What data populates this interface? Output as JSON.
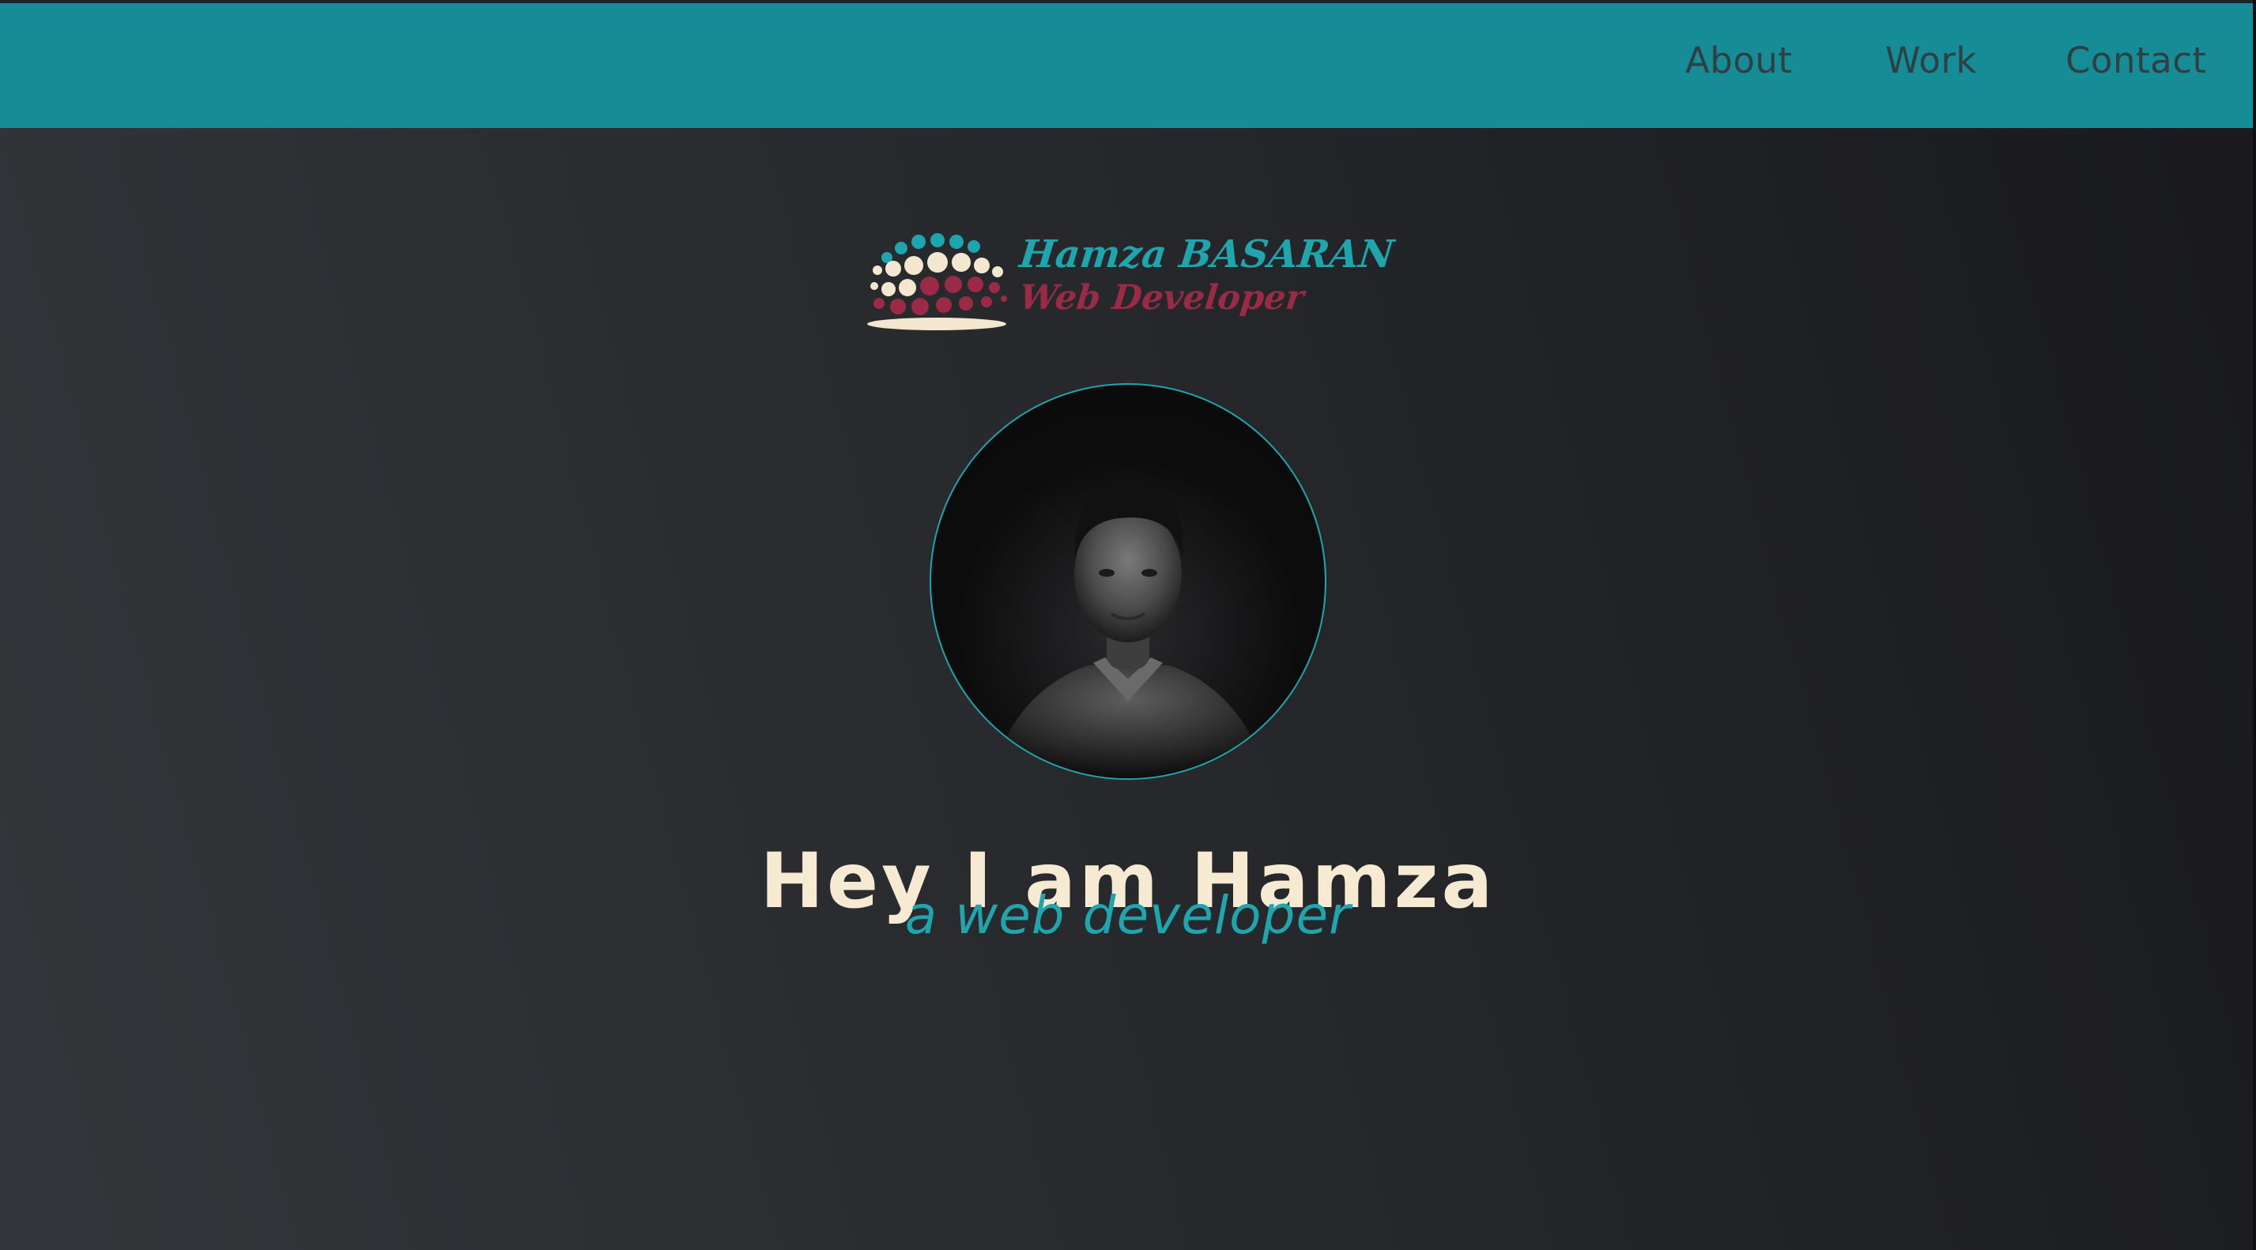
{
  "nav": {
    "links": [
      {
        "label": "About"
      },
      {
        "label": "Work"
      },
      {
        "label": "Contact"
      }
    ]
  },
  "logo": {
    "name": "Hamza BASARAN",
    "role": "Web Developer",
    "icon": "dotted-globe-logo-icon"
  },
  "profile": {
    "photo": "profile-photo"
  },
  "hero": {
    "title": "Hey I am Hamza",
    "subtitle": "a web developer"
  },
  "colors": {
    "nav_bg": "#168d96",
    "accent": "#1fa5ad",
    "title": "#f6ead2",
    "logo_red": "#9a2a45",
    "bg_dark": "#1b1b1e"
  }
}
